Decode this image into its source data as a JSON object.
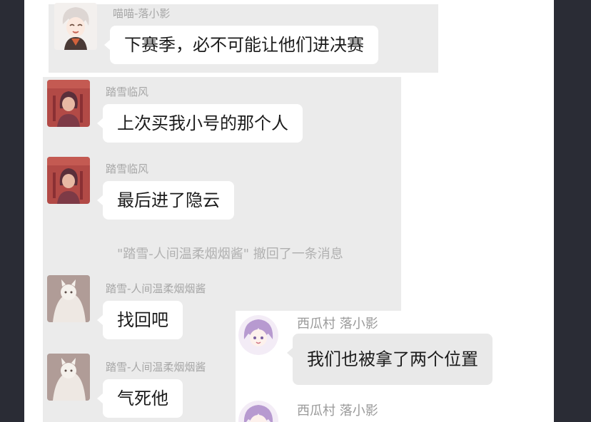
{
  "messages": [
    {
      "sender": "喵喵-落小影",
      "text": "下赛季，必不可能让他们进决赛",
      "avatar": "white-hair-character-icon"
    },
    {
      "sender": "踏雪临风",
      "text": "上次买我小号的那个人",
      "avatar": "red-pixel-character-icon"
    },
    {
      "sender": "踏雪临风",
      "text": "最后进了隐云",
      "avatar": "red-pixel-character-icon"
    },
    {
      "sender": "踏雪-人间温柔烟烟酱",
      "text": "找回吧",
      "avatar": "white-cat-icon"
    },
    {
      "sender": "踏雪-人间温柔烟烟酱",
      "text": "气死他",
      "avatar": "white-cat-icon"
    }
  ],
  "system_notice": "\"踏雪-人间温柔烟烟酱\" 撤回了一条消息",
  "overlay_messages": [
    {
      "sender": "西瓜村 落小影",
      "text": "我们也被拿了两个位置",
      "avatar": "purple-hair-girl-icon"
    },
    {
      "sender": "西瓜村 落小影",
      "text": "",
      "avatar": "purple-hair-girl-icon"
    }
  ],
  "colors": {
    "frame": "#2a2c35",
    "chat_background": "#ebebeb",
    "bubble": "#ffffff",
    "name_text": "#a7a7a7"
  }
}
